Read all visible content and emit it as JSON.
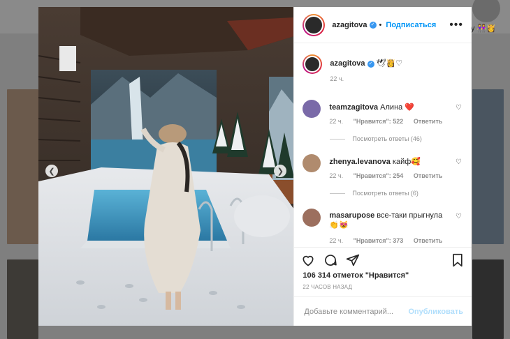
{
  "background": {
    "right_emojis": "y 👭👸"
  },
  "photo": {
    "prev_icon": "chevron-left",
    "next_icon": "chevron-right"
  },
  "post": {
    "author": "azagitova",
    "follow_label": "Подписаться",
    "caption_emojis": "🕊👸♡",
    "caption_time": "22 ч.",
    "comments": [
      {
        "user": "teamzagitova",
        "text": "Алина ❤️",
        "time": "22 ч.",
        "likes": "\"Нравится\": 522",
        "reply_label": "Ответить",
        "view_replies": "Посмотреть ответы (46)"
      },
      {
        "user": "zhenya.levanova",
        "text": "кайф🥰",
        "time": "22 ч.",
        "likes": "\"Нравится\": 254",
        "reply_label": "Ответить",
        "view_replies": "Посмотреть ответы (6)"
      },
      {
        "user": "masarupose",
        "text": "все-таки прыгнула 👏😻",
        "time": "22 ч.",
        "likes": "\"Нравится\": 373",
        "reply_label": "Ответить"
      }
    ],
    "like_count": "106 314 отметок \"Нравится\"",
    "posted_ago": "22 ЧАСОВ НАЗАД",
    "comment_placeholder": "Добавьте комментарий...",
    "publish_label": "Опубликовать"
  }
}
